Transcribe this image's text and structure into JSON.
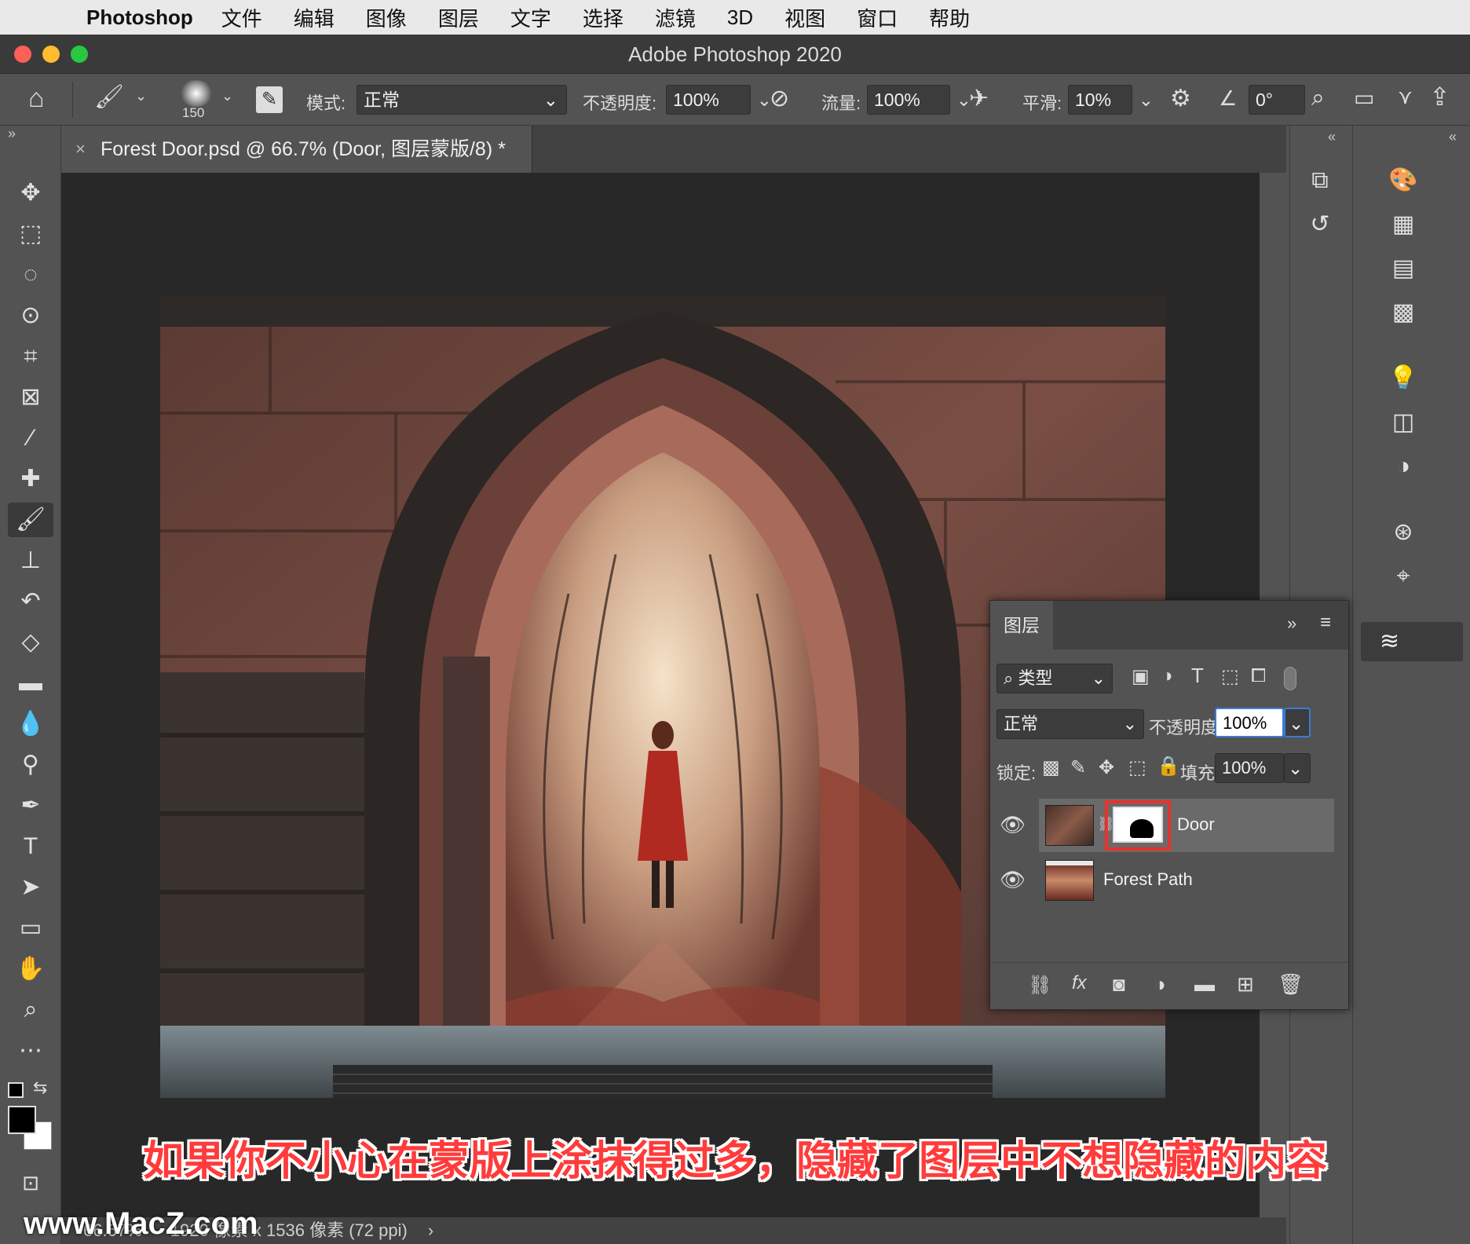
{
  "menubar": {
    "app_name": "Photoshop",
    "items": [
      "文件",
      "编辑",
      "图像",
      "图层",
      "文字",
      "选择",
      "滤镜",
      "3D",
      "视图",
      "窗口",
      "帮助"
    ]
  },
  "window": {
    "title": "Adobe Photoshop 2020"
  },
  "options_bar": {
    "brush_size": "150",
    "mode_label": "模式:",
    "mode_value": "正常",
    "opacity_label": "不透明度:",
    "opacity_value": "100%",
    "flow_label": "流量:",
    "flow_value": "100%",
    "smooth_label": "平滑:",
    "smooth_value": "10%",
    "angle_value": "0°"
  },
  "document": {
    "tab_title": "Forest Door.psd @ 66.7% (Door, 图层蒙版/8) *",
    "status_zoom": "66.67%",
    "status_info": "1920 像素 x 1536 像素 (72 ppi)"
  },
  "layers_panel": {
    "title": "图层",
    "filter_kind": "类型",
    "blend_mode": "正常",
    "opacity_label": "不透明度:",
    "opacity_value": "100%",
    "lock_label": "锁定:",
    "fill_label": "填充:",
    "fill_value": "100%",
    "layers": [
      {
        "name": "Door",
        "selected": true,
        "has_mask": true
      },
      {
        "name": "Forest Path",
        "selected": false,
        "has_mask": false
      }
    ]
  },
  "subtitle": "如果你不小心在蒙版上涂抹得过多，隐藏了图层中不想隐藏的内容",
  "watermark": "www.MacZ.com",
  "colors": {
    "highlight_box": "#e8322c",
    "subtitle": "#ff3b3b"
  }
}
